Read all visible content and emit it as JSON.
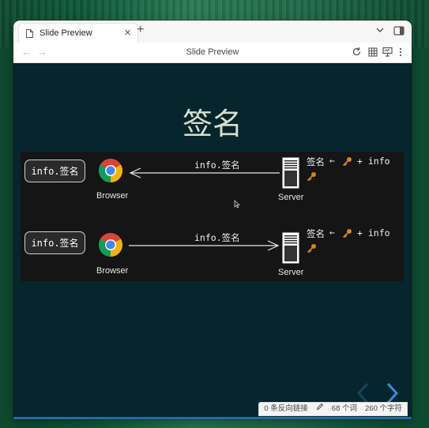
{
  "window": {
    "tab_label": "Slide Preview",
    "nav_title": "Slide Preview"
  },
  "slide": {
    "title": "签名",
    "rows": [
      {
        "box_label": "info.签名",
        "client_label": "Browser",
        "arrow_label": "info.签名",
        "direction": "server-to-browser",
        "server_label": "Server",
        "formula_sign": "签名",
        "formula_rest": "+ info"
      },
      {
        "box_label": "info.签名",
        "client_label": "Browser",
        "arrow_label": "info.签名",
        "direction": "browser-to-server",
        "server_label": "Server",
        "formula_sign": "签名",
        "formula_rest": "+ info"
      }
    ]
  },
  "statusbar": {
    "backlinks": "0 条反向链接",
    "words": "68 个词",
    "chars": "260 个字符"
  },
  "colors": {
    "slide_bg": "#06252d",
    "diagram_bg": "#151515",
    "key": "#d08a1a"
  }
}
